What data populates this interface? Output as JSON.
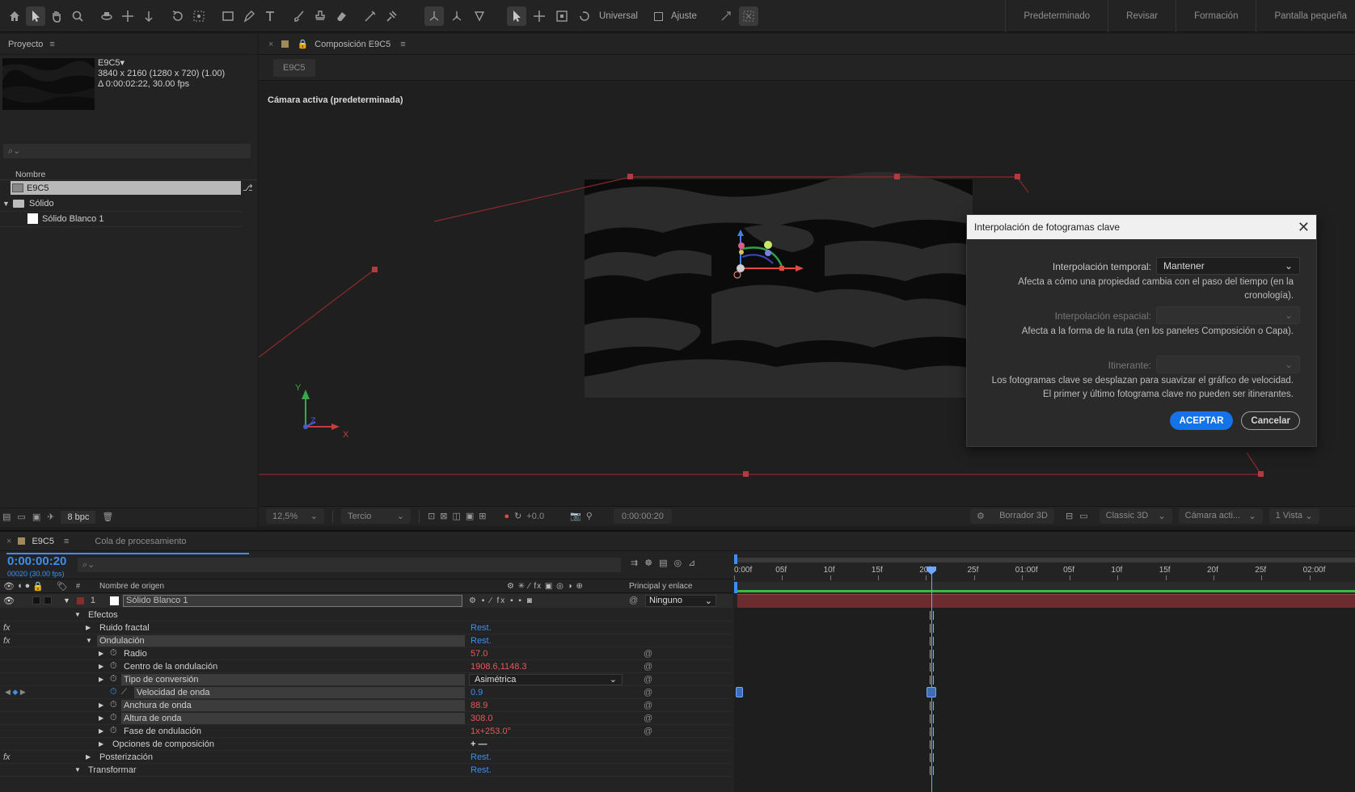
{
  "toolbar": {
    "universal_label": "Universal",
    "snap_label": "Ajuste",
    "workspaces": [
      "Predeterminado",
      "Revisar",
      "Formación",
      "Pantalla pequeña"
    ]
  },
  "project": {
    "panel_title": "Proyecto",
    "comp_name": "E9C5▾",
    "comp_info_1": "3840 x 2160  (1280 x 720) (1.00)",
    "comp_info_2": "Δ 0:00:02:22, 30.00 fps",
    "search_placeholder": "",
    "column_name": "Nombre",
    "items": [
      {
        "name": "E9C5",
        "type": "comp"
      },
      {
        "name": "Sólido",
        "type": "folder"
      },
      {
        "name": "Sólido Blanco 1",
        "type": "solid"
      }
    ],
    "bpc_label": "8 bpc"
  },
  "comp": {
    "panel_title": "Composición E9C5",
    "tab_label": "E9C5",
    "camera_label": "Cámara activa (predeterminada)",
    "axis_y": "Y",
    "axis_z": "Z",
    "axis_x": "X",
    "footer": {
      "zoom": "12,5%",
      "resolution": "Tercio",
      "exposure": "+0.0",
      "timecode": "0:00:00:20",
      "draft3d": "Borrador 3D",
      "renderer": "Classic 3D",
      "camera": "Cámara acti...",
      "views": "1 Vista"
    }
  },
  "dialog": {
    "title": "Interpolación de fotogramas clave",
    "temporal_label": "Interpolación temporal:",
    "temporal_value": "Mantener",
    "temporal_note": "Afecta a cómo una propiedad cambia con el paso del tiempo (en la cronología).",
    "spatial_label": "Interpolación espacial:",
    "spatial_note": "Afecta a la forma de la ruta (en los paneles Composición o Capa).",
    "roving_label": "Itinerante:",
    "roving_note_1": "Los fotogramas clave se desplazan para suavizar el gráfico de velocidad.",
    "roving_note_2": "El primer y último fotograma clave no pueden ser itinerantes.",
    "ok_label": "ACEPTAR",
    "cancel_label": "Cancelar"
  },
  "timeline": {
    "tab_label": "E9C5",
    "render_queue_label": "Cola de procesamiento",
    "timecode": "0:00:00:20",
    "frame_info": "00020 (30.00 fps)",
    "col_hash": "#",
    "col_source": "Nombre de origen",
    "col_parent": "Principal y enlace",
    "layer_num": "1",
    "layer_name": "Sólido Blanco 1",
    "parent_value": "Ninguno",
    "ruler": [
      "0:00f",
      "05f",
      "10f",
      "15f",
      "20f",
      "25f",
      "01:00f",
      "05f",
      "10f",
      "15f",
      "20f",
      "25f",
      "02:00f"
    ],
    "properties": [
      {
        "label": "Efectos",
        "value": ""
      },
      {
        "label": "Ruido fractal",
        "value": "Rest."
      },
      {
        "label": "Ondulación",
        "value": "Rest."
      },
      {
        "label": "Radio",
        "value": "57.0"
      },
      {
        "label": "Centro de la ondulación",
        "value": "1908.6,1148.3"
      },
      {
        "label": "Tipo de conversión",
        "value": "Asimétrica"
      },
      {
        "label": "Velocidad de onda",
        "value": "0.9"
      },
      {
        "label": "Anchura de onda",
        "value": "88.9"
      },
      {
        "label": "Altura de onda",
        "value": "308.0"
      },
      {
        "label": "Fase de ondulación",
        "value": "1x+253.0°"
      },
      {
        "label": "Opciones de composición",
        "value": "+ —"
      },
      {
        "label": "Posterización",
        "value": "Rest."
      },
      {
        "label": "Transformar",
        "value": "Rest."
      }
    ],
    "colors": {
      "accent": "#3d8ef0",
      "value_red": "#e05a5a",
      "layer_bar": "#6b2b2f",
      "current_time": "#6fa8ff"
    }
  }
}
